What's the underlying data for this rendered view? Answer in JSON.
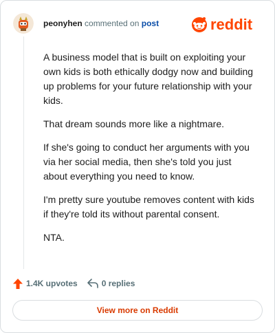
{
  "header": {
    "author": "peonyhen",
    "commented_on": "commented on",
    "post_link": "post",
    "brand_name": "reddit"
  },
  "comment": {
    "paragraphs": [
      "A business model that is built on exploiting your own kids is both ethically dodgy now and building up problems for your future relationship with your kids.",
      "That dream sounds more like a nightmare.",
      "If she's going to conduct her arguments with you via her social media, then she's told you just about everything you need to know.",
      "I'm pretty sure youtube removes content with kids if they're told its without parental consent.",
      "NTA."
    ]
  },
  "actions": {
    "upvotes_label": "1.4K upvotes",
    "replies_label": "0 replies"
  },
  "cta": {
    "label": "View more on Reddit"
  },
  "colors": {
    "brand": "#ff4500",
    "link": "#0a4da8",
    "cta_text": "#d93a00",
    "muted": "#576f76"
  },
  "icons": {
    "avatar": "avatar-image",
    "brand": "reddit-logo",
    "upvote": "upvote-arrow-icon",
    "reply": "reply-arrow-icon"
  }
}
